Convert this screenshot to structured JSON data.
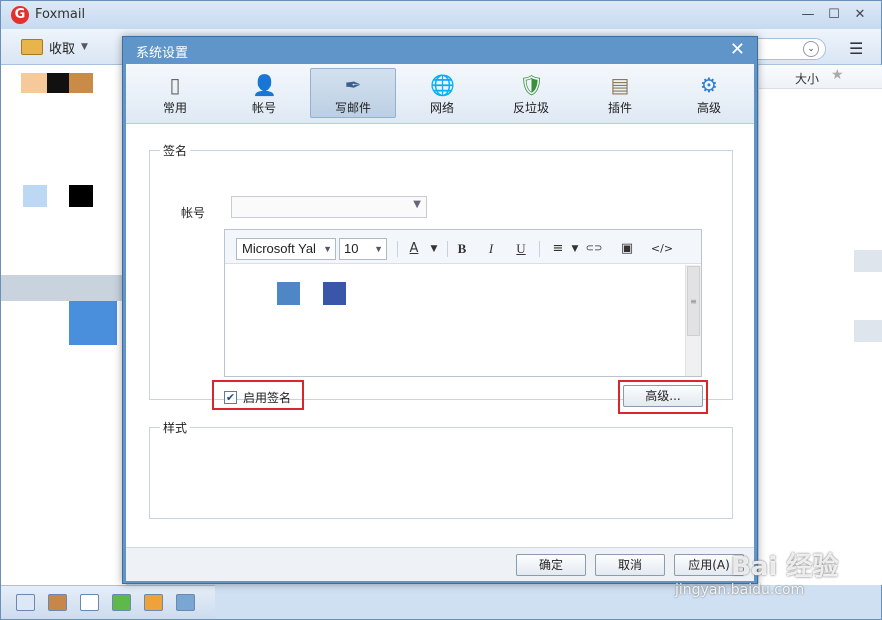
{
  "app": {
    "title": "Foxmail",
    "logo": "G"
  },
  "toolbar": {
    "receive_label": "收取",
    "caret": "▼",
    "dropdown_glyph": "⌄",
    "menu_glyph": "☰"
  },
  "window_controls": {
    "minimize": "—",
    "maximize": "☐",
    "close": "✕"
  },
  "mail_list": {
    "size_header": "大小",
    "star_glyph": "★"
  },
  "dialog": {
    "title": "系统设置",
    "close_glyph": "✕",
    "categories": [
      {
        "label": "常用",
        "icon": "phone-icon",
        "glyph": "▯"
      },
      {
        "label": "帐号",
        "icon": "user-icon",
        "glyph": "👤"
      },
      {
        "label": "写邮件",
        "icon": "inkwell-icon",
        "glyph": "✒"
      },
      {
        "label": "网络",
        "icon": "globe-icon",
        "glyph": "🌐"
      },
      {
        "label": "反垃圾",
        "icon": "shield-icon",
        "glyph": "🛡"
      },
      {
        "label": "插件",
        "icon": "box-icon",
        "glyph": "▤"
      },
      {
        "label": "高级",
        "icon": "gear-icon",
        "glyph": "⚙"
      }
    ],
    "active_category": "写邮件",
    "signature": {
      "group_title": "签名",
      "account_label": "帐号",
      "account_value": "",
      "font_family": "Microsoft Yal",
      "font_size": "10",
      "toolbar_glyphs": {
        "font_color": "A",
        "bold": "B",
        "italic": "I",
        "underline": "U",
        "align": "≡",
        "link": "⊂⊃",
        "image": "▣",
        "code": "</>"
      },
      "enable_label": "启用签名",
      "enable_checked": "✔",
      "advanced_button": "高级..."
    },
    "style": {
      "group_title": "样式"
    },
    "footer": {
      "ok": "确定",
      "cancel": "取消",
      "apply": "应用(A)"
    }
  },
  "watermark": {
    "text": "Bai 经验",
    "url": "jingyan.baidu.com"
  },
  "colors": {
    "dialog_frame": "#5f95c9",
    "highlight": "#d9262c",
    "swatch_light": "#4f86c6",
    "swatch_dark": "#3a56a8"
  }
}
